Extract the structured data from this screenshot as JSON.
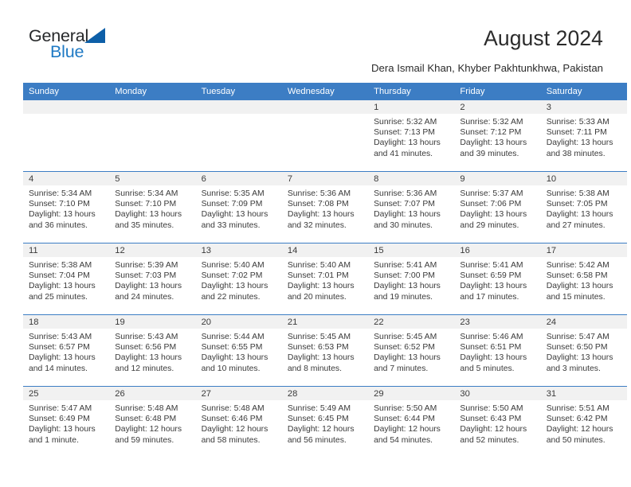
{
  "brand": {
    "name_top": "General",
    "name_bottom": "Blue",
    "accent_color": "#1f7ac4",
    "triangle_color": "#0d5fa8"
  },
  "header": {
    "title": "August 2024",
    "location": "Dera Ismail Khan, Khyber Pakhtunkhwa, Pakistan"
  },
  "calendar": {
    "header_bg": "#3c7dc4",
    "daynum_bg": "#f1f1f1",
    "weekday_headers": [
      "Sunday",
      "Monday",
      "Tuesday",
      "Wednesday",
      "Thursday",
      "Friday",
      "Saturday"
    ],
    "weeks": [
      [
        {
          "day": "",
          "sunrise": "",
          "sunset": "",
          "daylight": "",
          "empty": true
        },
        {
          "day": "",
          "sunrise": "",
          "sunset": "",
          "daylight": "",
          "empty": true
        },
        {
          "day": "",
          "sunrise": "",
          "sunset": "",
          "daylight": "",
          "empty": true
        },
        {
          "day": "",
          "sunrise": "",
          "sunset": "",
          "daylight": "",
          "empty": true
        },
        {
          "day": "1",
          "sunrise": "Sunrise: 5:32 AM",
          "sunset": "Sunset: 7:13 PM",
          "daylight": "Daylight: 13 hours and 41 minutes."
        },
        {
          "day": "2",
          "sunrise": "Sunrise: 5:32 AM",
          "sunset": "Sunset: 7:12 PM",
          "daylight": "Daylight: 13 hours and 39 minutes."
        },
        {
          "day": "3",
          "sunrise": "Sunrise: 5:33 AM",
          "sunset": "Sunset: 7:11 PM",
          "daylight": "Daylight: 13 hours and 38 minutes."
        }
      ],
      [
        {
          "day": "4",
          "sunrise": "Sunrise: 5:34 AM",
          "sunset": "Sunset: 7:10 PM",
          "daylight": "Daylight: 13 hours and 36 minutes."
        },
        {
          "day": "5",
          "sunrise": "Sunrise: 5:34 AM",
          "sunset": "Sunset: 7:10 PM",
          "daylight": "Daylight: 13 hours and 35 minutes."
        },
        {
          "day": "6",
          "sunrise": "Sunrise: 5:35 AM",
          "sunset": "Sunset: 7:09 PM",
          "daylight": "Daylight: 13 hours and 33 minutes."
        },
        {
          "day": "7",
          "sunrise": "Sunrise: 5:36 AM",
          "sunset": "Sunset: 7:08 PM",
          "daylight": "Daylight: 13 hours and 32 minutes."
        },
        {
          "day": "8",
          "sunrise": "Sunrise: 5:36 AM",
          "sunset": "Sunset: 7:07 PM",
          "daylight": "Daylight: 13 hours and 30 minutes."
        },
        {
          "day": "9",
          "sunrise": "Sunrise: 5:37 AM",
          "sunset": "Sunset: 7:06 PM",
          "daylight": "Daylight: 13 hours and 29 minutes."
        },
        {
          "day": "10",
          "sunrise": "Sunrise: 5:38 AM",
          "sunset": "Sunset: 7:05 PM",
          "daylight": "Daylight: 13 hours and 27 minutes."
        }
      ],
      [
        {
          "day": "11",
          "sunrise": "Sunrise: 5:38 AM",
          "sunset": "Sunset: 7:04 PM",
          "daylight": "Daylight: 13 hours and 25 minutes."
        },
        {
          "day": "12",
          "sunrise": "Sunrise: 5:39 AM",
          "sunset": "Sunset: 7:03 PM",
          "daylight": "Daylight: 13 hours and 24 minutes."
        },
        {
          "day": "13",
          "sunrise": "Sunrise: 5:40 AM",
          "sunset": "Sunset: 7:02 PM",
          "daylight": "Daylight: 13 hours and 22 minutes."
        },
        {
          "day": "14",
          "sunrise": "Sunrise: 5:40 AM",
          "sunset": "Sunset: 7:01 PM",
          "daylight": "Daylight: 13 hours and 20 minutes."
        },
        {
          "day": "15",
          "sunrise": "Sunrise: 5:41 AM",
          "sunset": "Sunset: 7:00 PM",
          "daylight": "Daylight: 13 hours and 19 minutes."
        },
        {
          "day": "16",
          "sunrise": "Sunrise: 5:41 AM",
          "sunset": "Sunset: 6:59 PM",
          "daylight": "Daylight: 13 hours and 17 minutes."
        },
        {
          "day": "17",
          "sunrise": "Sunrise: 5:42 AM",
          "sunset": "Sunset: 6:58 PM",
          "daylight": "Daylight: 13 hours and 15 minutes."
        }
      ],
      [
        {
          "day": "18",
          "sunrise": "Sunrise: 5:43 AM",
          "sunset": "Sunset: 6:57 PM",
          "daylight": "Daylight: 13 hours and 14 minutes."
        },
        {
          "day": "19",
          "sunrise": "Sunrise: 5:43 AM",
          "sunset": "Sunset: 6:56 PM",
          "daylight": "Daylight: 13 hours and 12 minutes."
        },
        {
          "day": "20",
          "sunrise": "Sunrise: 5:44 AM",
          "sunset": "Sunset: 6:55 PM",
          "daylight": "Daylight: 13 hours and 10 minutes."
        },
        {
          "day": "21",
          "sunrise": "Sunrise: 5:45 AM",
          "sunset": "Sunset: 6:53 PM",
          "daylight": "Daylight: 13 hours and 8 minutes."
        },
        {
          "day": "22",
          "sunrise": "Sunrise: 5:45 AM",
          "sunset": "Sunset: 6:52 PM",
          "daylight": "Daylight: 13 hours and 7 minutes."
        },
        {
          "day": "23",
          "sunrise": "Sunrise: 5:46 AM",
          "sunset": "Sunset: 6:51 PM",
          "daylight": "Daylight: 13 hours and 5 minutes."
        },
        {
          "day": "24",
          "sunrise": "Sunrise: 5:47 AM",
          "sunset": "Sunset: 6:50 PM",
          "daylight": "Daylight: 13 hours and 3 minutes."
        }
      ],
      [
        {
          "day": "25",
          "sunrise": "Sunrise: 5:47 AM",
          "sunset": "Sunset: 6:49 PM",
          "daylight": "Daylight: 13 hours and 1 minute."
        },
        {
          "day": "26",
          "sunrise": "Sunrise: 5:48 AM",
          "sunset": "Sunset: 6:48 PM",
          "daylight": "Daylight: 12 hours and 59 minutes."
        },
        {
          "day": "27",
          "sunrise": "Sunrise: 5:48 AM",
          "sunset": "Sunset: 6:46 PM",
          "daylight": "Daylight: 12 hours and 58 minutes."
        },
        {
          "day": "28",
          "sunrise": "Sunrise: 5:49 AM",
          "sunset": "Sunset: 6:45 PM",
          "daylight": "Daylight: 12 hours and 56 minutes."
        },
        {
          "day": "29",
          "sunrise": "Sunrise: 5:50 AM",
          "sunset": "Sunset: 6:44 PM",
          "daylight": "Daylight: 12 hours and 54 minutes."
        },
        {
          "day": "30",
          "sunrise": "Sunrise: 5:50 AM",
          "sunset": "Sunset: 6:43 PM",
          "daylight": "Daylight: 12 hours and 52 minutes."
        },
        {
          "day": "31",
          "sunrise": "Sunrise: 5:51 AM",
          "sunset": "Sunset: 6:42 PM",
          "daylight": "Daylight: 12 hours and 50 minutes."
        }
      ]
    ]
  }
}
